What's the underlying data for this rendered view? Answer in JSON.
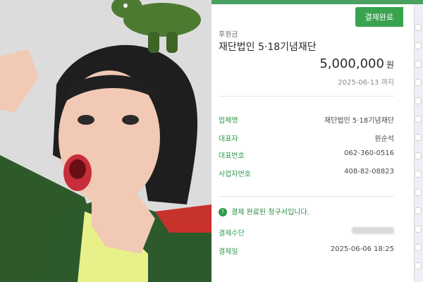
{
  "receipt": {
    "badge": "결제완료",
    "title_label": "후원금",
    "title": "재단법인 5·18기념재단",
    "amount": "5,000,000",
    "amount_unit": "원",
    "deadline": "2025-06-13 까지",
    "info_rows": [
      {
        "label": "업체명",
        "value": "재단법인 5·18기념재단"
      },
      {
        "label": "대표자",
        "value": "원순석"
      },
      {
        "label": "대표번호",
        "value": "062-360-0516"
      },
      {
        "label": "사업자번호",
        "value": "408-82-08823"
      }
    ],
    "notice": "결제 완료된 청구서입니다.",
    "payment_rows": [
      {
        "label": "결제수단",
        "value": ""
      },
      {
        "label": "결제일",
        "value": "2025-06-06 18:25"
      }
    ]
  },
  "colors": {
    "accent_green": "#39a34f",
    "label_green": "#2f9a4c"
  },
  "photo": {
    "icons": [
      "dinosaur-plush-icon",
      "woman-portrait"
    ]
  }
}
